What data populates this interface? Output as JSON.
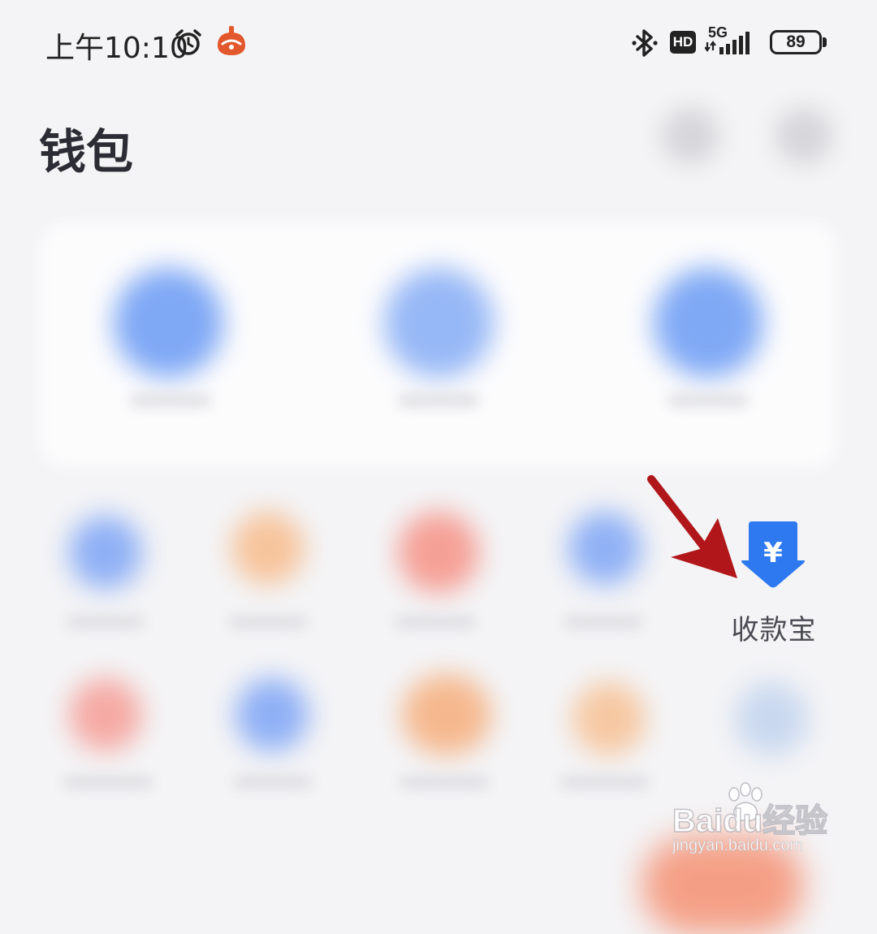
{
  "status_bar": {
    "time": "上午10:10",
    "network": "5G",
    "battery": "89"
  },
  "header": {
    "title": "钱包"
  },
  "main_card": {
    "items": [
      {
        "color": "#7fa8f5"
      },
      {
        "color": "#97b8f6"
      },
      {
        "color": "#80a9f5"
      }
    ]
  },
  "grid": {
    "row1": [
      {
        "color": "#8fb0f5"
      },
      {
        "color": "#f6c49c"
      },
      {
        "color": "#f5a096"
      },
      {
        "color": "#90b1f5"
      }
    ],
    "row2": [
      {
        "color": "#f5aaa4"
      },
      {
        "color": "#8fb0f5"
      },
      {
        "color": "#f5b88e"
      },
      {
        "color": "#f6c8a2"
      },
      {
        "color": "#c9d8ef"
      }
    ],
    "collect": {
      "label": "收款宝",
      "icon_symbol": "¥",
      "icon_color": "#2e79f0"
    }
  },
  "annotation": {
    "arrow_color": "#b0161a"
  },
  "watermark": {
    "brand": "Baidu经验",
    "url": "jingyan.baidu.com"
  },
  "colors": {
    "background": "#f4f4f6",
    "accent": "#2e79f0"
  }
}
